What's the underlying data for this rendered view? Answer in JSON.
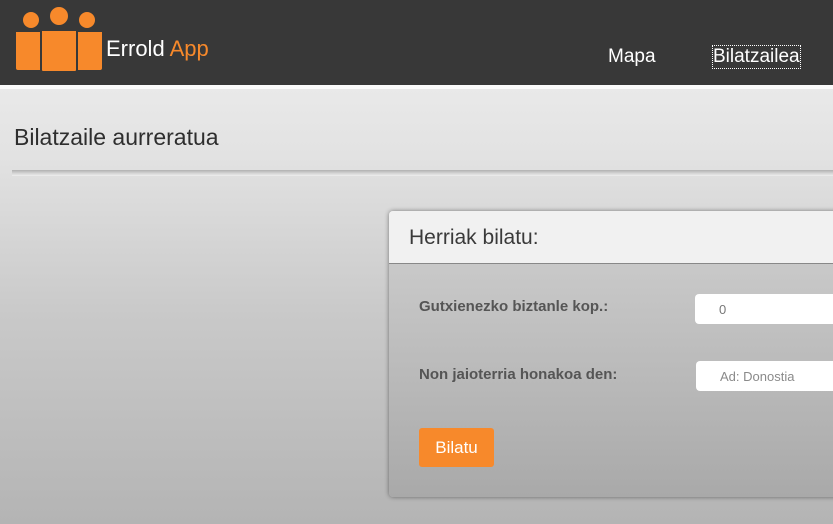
{
  "navbar": {
    "brand_primary": "Errold",
    "brand_accent": "App",
    "links": [
      "Mapa",
      "Bilatzailea"
    ]
  },
  "page": {
    "title": "Bilatzaile aurreratua"
  },
  "panel": {
    "title": "Herriak bilatu:",
    "min_population_label": "Gutxienezko biztanle kop.:",
    "min_population_value": "0",
    "birthplace_label": "Non jaioterria honakoa den:",
    "birthplace_placeholder": "Ad: Donostia",
    "search_button": "Bilatu"
  },
  "colors": {
    "navbar_bg": "#383838",
    "accent": "#f7892b"
  },
  "icons": {
    "logo": "people-group-icon"
  }
}
